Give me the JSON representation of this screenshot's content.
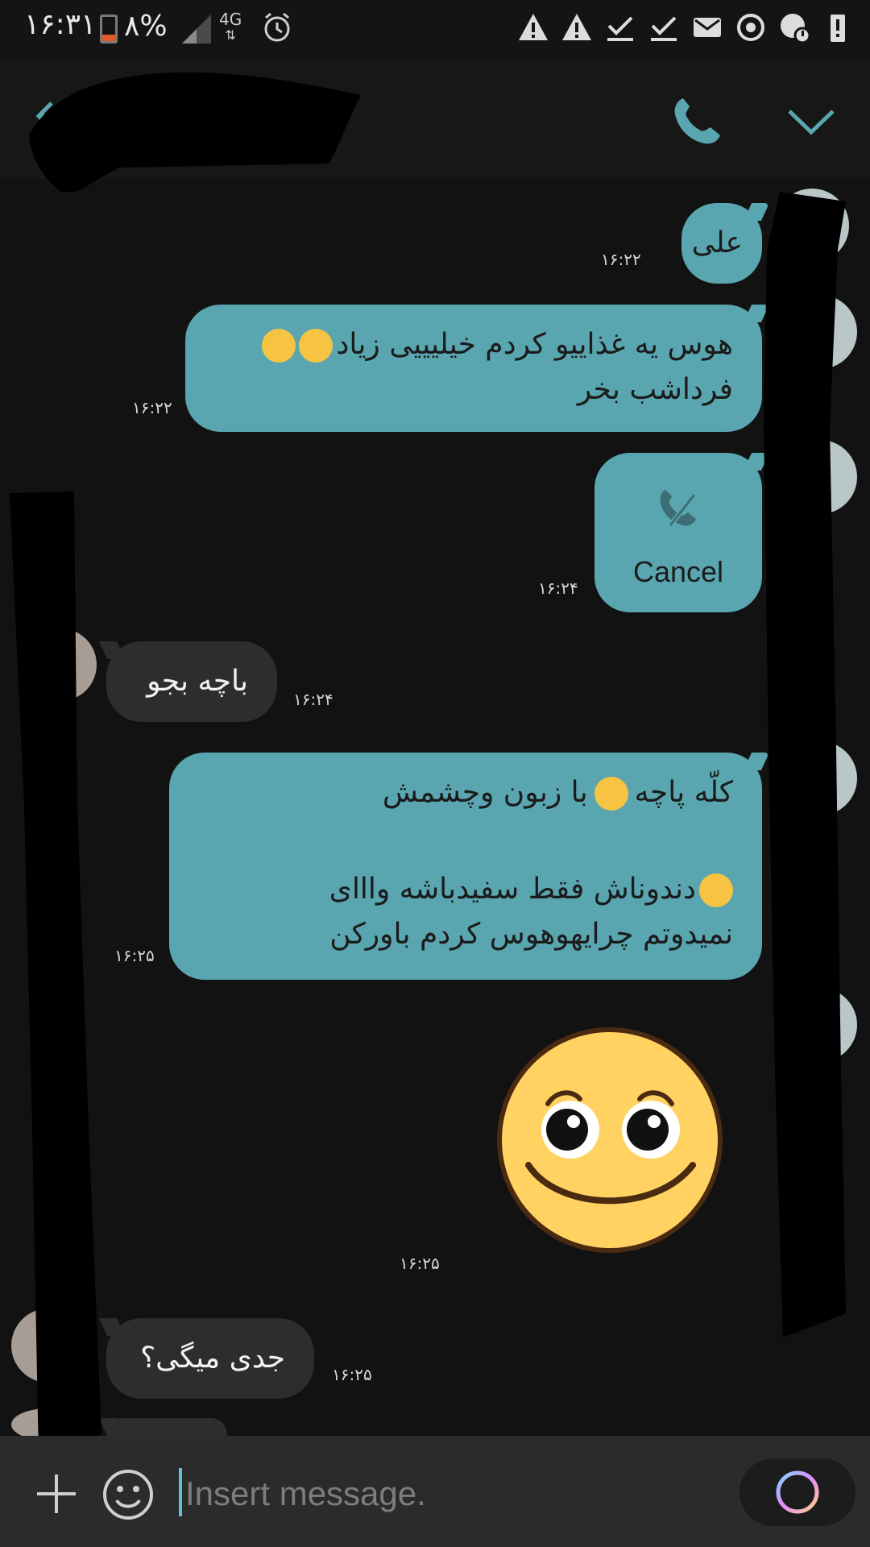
{
  "status_bar": {
    "time": "۱۶:۳۱",
    "battery_percent": "۸%",
    "network": "4G"
  },
  "header": {
    "contact_name_redacted": true
  },
  "messages": [
    {
      "direction": "sent",
      "text_lines": [
        "علی"
      ],
      "time": "۱۶:۲۲"
    },
    {
      "direction": "sent",
      "text_lines": [
        "هوس یه غذاییو کردم خیلیییی زیاد",
        "فرداشب بخر"
      ],
      "time": "۱۶:۲۲"
    },
    {
      "direction": "sent",
      "type": "call",
      "label": "Cancel",
      "time": "۱۶:۲۴"
    },
    {
      "direction": "received",
      "text_lines": [
        "باچه بجو"
      ],
      "time": "۱۶:۲۴"
    },
    {
      "direction": "sent",
      "text_lines": [
        "کلّه پاچه",
        "با زبون وچشمش",
        "دندوناش فقط سفیدباشه  واااى",
        "نمیدوتم چرایهوهوس کردم باورکن"
      ],
      "time": "۱۶:۲۵"
    },
    {
      "direction": "sent",
      "type": "sticker",
      "time": "۱۶:۲۵"
    },
    {
      "direction": "received",
      "text_lines": [
        "جدی میگی؟"
      ],
      "time": "۱۶:۲۵"
    }
  ],
  "composer": {
    "placeholder": "Insert message."
  },
  "colors": {
    "accent": "#5aa6b0",
    "background": "#121212",
    "received_bubble": "#2d2d2f"
  }
}
